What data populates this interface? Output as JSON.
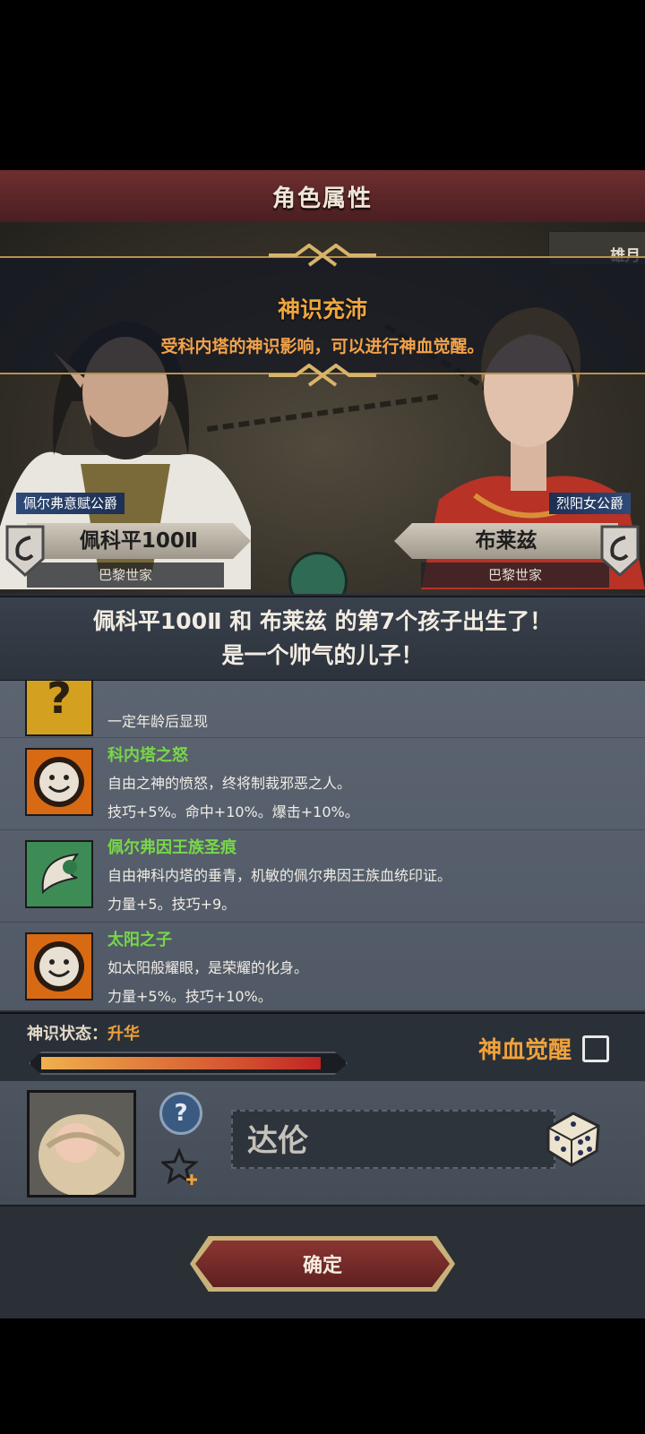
{
  "header": {
    "title": "角色属性"
  },
  "banner": {
    "heading": "神识充沛",
    "subtext": "受科内塔的神识影响，可以进行神血觉醒。"
  },
  "corner_text": "雄月",
  "father": {
    "title": "佩尔弗意赋公爵",
    "name": "佩科平100Ⅱ",
    "house": "巴黎世家"
  },
  "mother": {
    "title": "烈阳女公爵",
    "name": "布莱兹",
    "house": "巴黎世家"
  },
  "announcement": {
    "line1": "佩科平100Ⅱ 和 布莱兹 的第7个孩子出生了！",
    "line2": "是一个帅气的儿子！"
  },
  "traits": [
    {
      "icon": "question-mark-icon",
      "name": "",
      "desc": "一定年龄后显现",
      "stats": ""
    },
    {
      "icon": "smiling-sun-icon",
      "name": "科内塔之怒",
      "desc": "自由之神的愤怒，终将制裁邪恶之人。",
      "stats": "技巧+5%。命中+10%。爆击+10%。"
    },
    {
      "icon": "feather-moon-icon",
      "name": "佩尔弗因王族圣痕",
      "desc": "自由神科内塔的垂青，机敏的佩尔弗因王族血统印证。",
      "stats": "力量+5。技巧+9。"
    },
    {
      "icon": "smiling-sun-icon",
      "name": "太阳之子",
      "desc": "如太阳般耀眼，是荣耀的化身。",
      "stats": "力量+5%。技巧+10%。"
    }
  ],
  "status": {
    "label": "神识状态：",
    "value": "升华",
    "progress": 0.95,
    "awaken_label": "神血觉醒",
    "awaken_checked": false
  },
  "naming": {
    "child_name": "达伦"
  },
  "footer": {
    "confirm_label": "确定"
  },
  "colors": {
    "accent_orange": "#f0a23c",
    "trait_name_green": "#78d64a",
    "title_red": "#6e2f2f"
  }
}
